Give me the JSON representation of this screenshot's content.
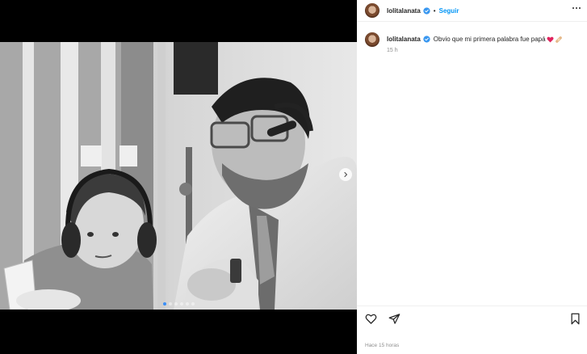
{
  "post": {
    "username": "lolitalanata",
    "follow_label": "Seguir",
    "separator": "•",
    "caption_text": "Obvio que mi primera palabra fue papá",
    "caption_emojis": [
      "red-heart",
      "adhesive-bandage"
    ],
    "relative_time": "15 h",
    "footer_time": "Hace 15 horas"
  },
  "carousel": {
    "slide_count": 6,
    "active_slide": 1
  },
  "colors": {
    "link_blue": "#0095f6",
    "verified_blue": "#3897f0",
    "heart_red": "#e0245e"
  },
  "icons": {
    "like": "heart-outline-icon",
    "share": "paper-plane-icon",
    "save": "bookmark-icon",
    "next": "chevron-right-icon",
    "more": "more-options-icon",
    "verified": "verified-badge-icon"
  }
}
